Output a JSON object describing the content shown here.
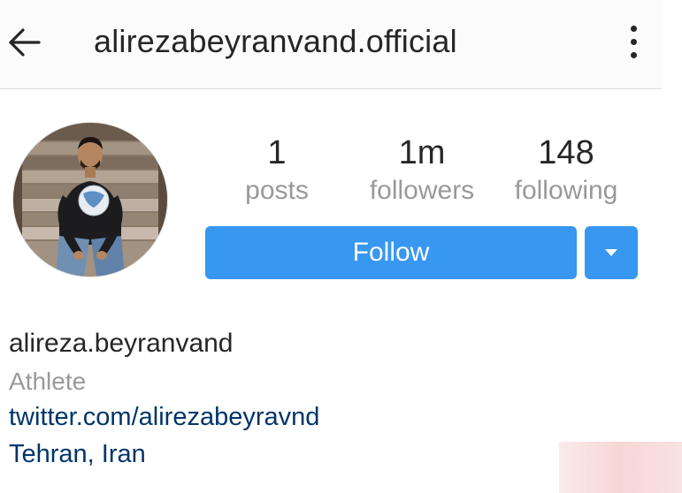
{
  "header": {
    "title": "alirezabeyranvand.official",
    "back_icon": "arrow-left-icon",
    "more_icon": "vertical-dots-icon"
  },
  "profile": {
    "avatar_description": "profile-photo",
    "stats": {
      "posts_count": "1",
      "posts_label": "posts",
      "followers_count": "1m",
      "followers_label": "followers",
      "following_count": "148",
      "following_label": "following"
    },
    "follow_label": "Follow",
    "dropdown_icon": "caret-down-icon"
  },
  "bio": {
    "name": "alireza.beyranvand",
    "category": "Athlete",
    "link": "twitter.com/alirezabeyravnd",
    "location": "Tehran, Iran"
  },
  "colors": {
    "accent": "#3897f0",
    "link": "#003569",
    "muted": "#999999",
    "text": "#262626"
  }
}
